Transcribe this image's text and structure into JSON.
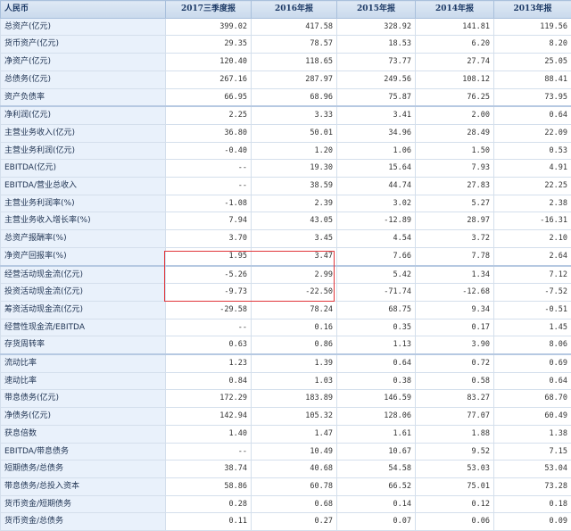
{
  "header": {
    "label": "人民币",
    "columns": [
      "2017三季度报",
      "2016年报",
      "2015年报",
      "2014年报",
      "2013年报"
    ]
  },
  "colors": {
    "highlight_box": "#e0363b",
    "header_bg": "#c9d9ec",
    "label_bg": "#e9f1fb"
  },
  "rows": [
    {
      "label": "总资产(亿元)",
      "values": [
        "399.02",
        "417.58",
        "328.92",
        "141.81",
        "119.56"
      ]
    },
    {
      "label": "货币资产(亿元)",
      "values": [
        "29.35",
        "78.57",
        "18.53",
        "6.20",
        "8.20"
      ]
    },
    {
      "label": "净资产(亿元)",
      "values": [
        "120.40",
        "118.65",
        "73.77",
        "27.74",
        "25.05"
      ]
    },
    {
      "label": "总债务(亿元)",
      "values": [
        "267.16",
        "287.97",
        "249.56",
        "108.12",
        "88.41"
      ]
    },
    {
      "label": "资产负债率",
      "values": [
        "66.95",
        "68.96",
        "75.87",
        "76.25",
        "73.95"
      ]
    },
    {
      "label": "净利润(亿元)",
      "values": [
        "2.25",
        "3.33",
        "3.41",
        "2.00",
        "0.64"
      ]
    },
    {
      "label": "主营业务收入(亿元)",
      "values": [
        "36.80",
        "50.01",
        "34.96",
        "28.49",
        "22.09"
      ]
    },
    {
      "label": "主营业务利润(亿元)",
      "values": [
        "-0.40",
        "1.20",
        "1.06",
        "1.50",
        "0.53"
      ]
    },
    {
      "label": "EBITDA(亿元)",
      "values": [
        "--",
        "19.30",
        "15.64",
        "7.93",
        "4.91"
      ]
    },
    {
      "label": "EBITDA/营业总收入",
      "values": [
        "--",
        "38.59",
        "44.74",
        "27.83",
        "22.25"
      ]
    },
    {
      "label": "主营业务利润率(%)",
      "values": [
        "-1.08",
        "2.39",
        "3.02",
        "5.27",
        "2.38"
      ]
    },
    {
      "label": "主营业务收入增长率(%)",
      "values": [
        "7.94",
        "43.05",
        "-12.89",
        "28.97",
        "-16.31"
      ]
    },
    {
      "label": "总资产报酬率(%)",
      "values": [
        "3.70",
        "3.45",
        "4.54",
        "3.72",
        "2.10"
      ]
    },
    {
      "label": "净资产回报率(%)",
      "values": [
        "1.95",
        "3.47",
        "7.66",
        "7.78",
        "2.64"
      ]
    },
    {
      "label": "经营活动现金流(亿元)",
      "values": [
        "-5.26",
        "2.99",
        "5.42",
        "1.34",
        "7.12"
      ]
    },
    {
      "label": "投资活动现金流(亿元)",
      "values": [
        "-9.73",
        "-22.50",
        "-71.74",
        "-12.68",
        "-7.52"
      ]
    },
    {
      "label": "筹资活动现金流(亿元)",
      "values": [
        "-29.58",
        "78.24",
        "68.75",
        "9.34",
        "-0.51"
      ]
    },
    {
      "label": "经营性现金流/EBITDA",
      "values": [
        "--",
        "0.16",
        "0.35",
        "0.17",
        "1.45"
      ]
    },
    {
      "label": "存货周转率",
      "values": [
        "0.63",
        "0.86",
        "1.13",
        "3.90",
        "8.06"
      ]
    },
    {
      "label": "流动比率",
      "values": [
        "1.23",
        "1.39",
        "0.64",
        "0.72",
        "0.69"
      ]
    },
    {
      "label": "速动比率",
      "values": [
        "0.84",
        "1.03",
        "0.38",
        "0.58",
        "0.64"
      ]
    },
    {
      "label": "带息债务(亿元)",
      "values": [
        "172.29",
        "183.89",
        "146.59",
        "83.27",
        "68.70"
      ]
    },
    {
      "label": "净债务(亿元)",
      "values": [
        "142.94",
        "105.32",
        "128.06",
        "77.07",
        "60.49"
      ]
    },
    {
      "label": "获息倍数",
      "values": [
        "1.40",
        "1.47",
        "1.61",
        "1.88",
        "1.38"
      ]
    },
    {
      "label": "EBITDA/带息债务",
      "values": [
        "--",
        "10.49",
        "10.67",
        "9.52",
        "7.15"
      ]
    },
    {
      "label": "短期债务/总债务",
      "values": [
        "38.74",
        "40.68",
        "54.58",
        "53.03",
        "53.04"
      ]
    },
    {
      "label": "带息债务/总投入资本",
      "values": [
        "58.86",
        "60.78",
        "66.52",
        "75.01",
        "73.28"
      ]
    },
    {
      "label": "货币资金/短期债务",
      "values": [
        "0.28",
        "0.68",
        "0.14",
        "0.12",
        "0.18"
      ]
    },
    {
      "label": "货币资金/总债务",
      "values": [
        "0.11",
        "0.27",
        "0.07",
        "0.06",
        "0.09"
      ]
    }
  ]
}
